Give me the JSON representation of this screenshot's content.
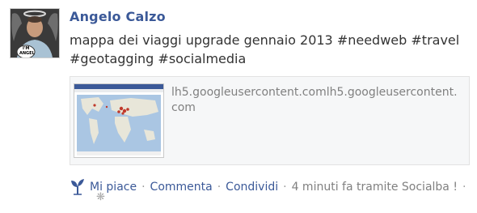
{
  "post": {
    "author": "Angelo Calzo",
    "message": "mappa dei viaggi upgrade gennaio 2013 #needweb #travel #geotagging #socialmedia",
    "avatar": {
      "badge_line1": "I'M",
      "badge_line2": "ANGEL"
    }
  },
  "link_preview": {
    "url_text": "lh5.googleusercontent.comlh5.googleusercontent.com",
    "thumbnail_icon": "map-thumbnail"
  },
  "actions": {
    "like_label": "Mi piace",
    "comment_label": "Commenta",
    "share_label": "Condividi",
    "time_text": "4 minuti fa tramite Socialba !",
    "separator": "·",
    "like_icon": "like-sprout-icon",
    "settings_icon": "gear-icon",
    "settings_glyph": "❋"
  },
  "colors": {
    "name_blue": "#3b5998",
    "meta_gray": "#808080",
    "card_bg": "#f6f7f8"
  }
}
